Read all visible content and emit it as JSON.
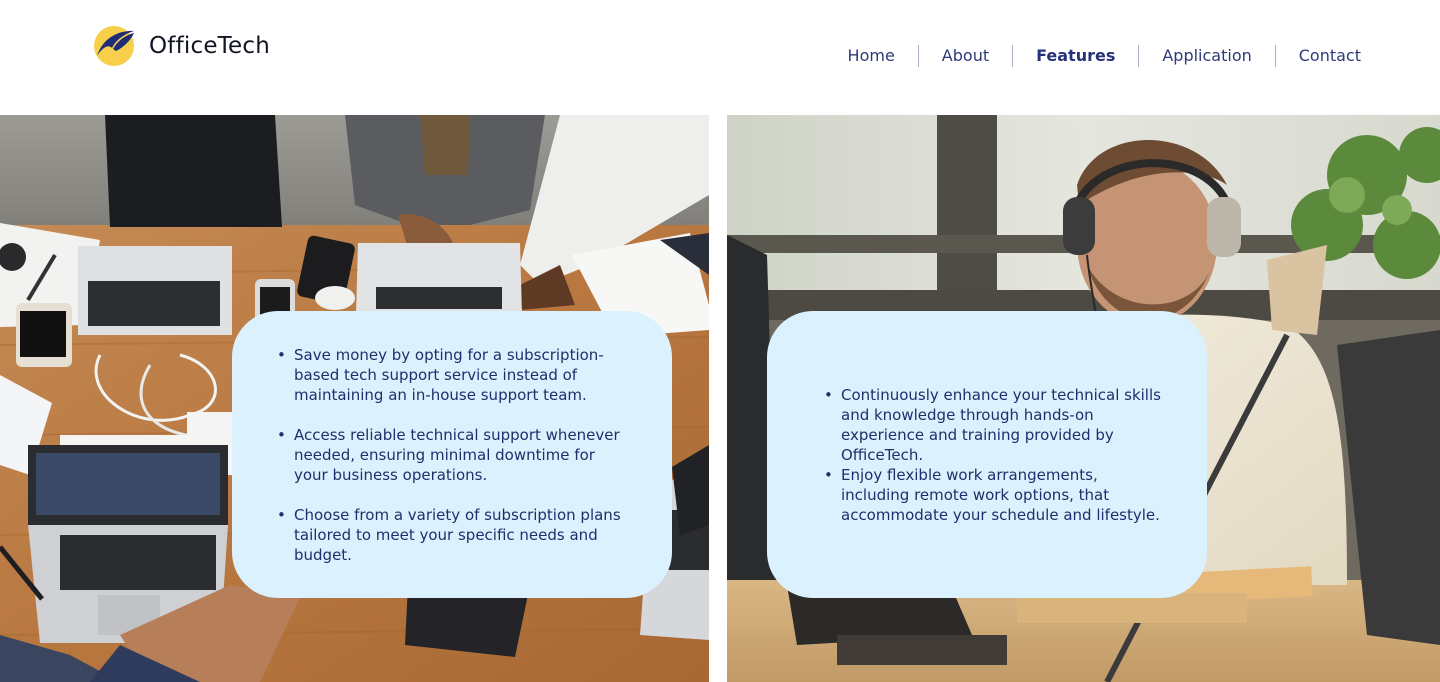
{
  "brand": {
    "name": "OfficeTech",
    "logo_icon": "crescent-swoosh-icon",
    "logo_colors": {
      "circle": "#f8cf4b",
      "swoosh": "#1f2d78"
    }
  },
  "nav": {
    "items": [
      {
        "label": "Home",
        "active": false
      },
      {
        "label": "About",
        "active": false
      },
      {
        "label": "Features",
        "active": true
      },
      {
        "label": "Application",
        "active": false
      },
      {
        "label": "Contact",
        "active": false
      }
    ]
  },
  "panels": {
    "left": {
      "image": "team-working-on-laptops-around-wooden-table",
      "bullets": [
        "Save money by opting for a subscription-based tech support service instead of maintaining an in-house support team.",
        "Access reliable technical support whenever needed, ensuring minimal downtime for your business operations.",
        "Choose from a variety of subscription plans tailored to meet your specific needs and budget."
      ]
    },
    "right": {
      "image": "man-with-headphones-working-at-desk",
      "bullets": [
        "Continuously enhance your technical skills and knowledge through hands-on experience and training provided by OfficeTech.",
        "Enjoy flexible work arrangements, including remote work options, that accommodate your schedule and lifestyle."
      ]
    }
  },
  "colors": {
    "nav_text": "#2d3a78",
    "card_background": "#dcf1fe",
    "card_text": "#1f2f6b"
  }
}
